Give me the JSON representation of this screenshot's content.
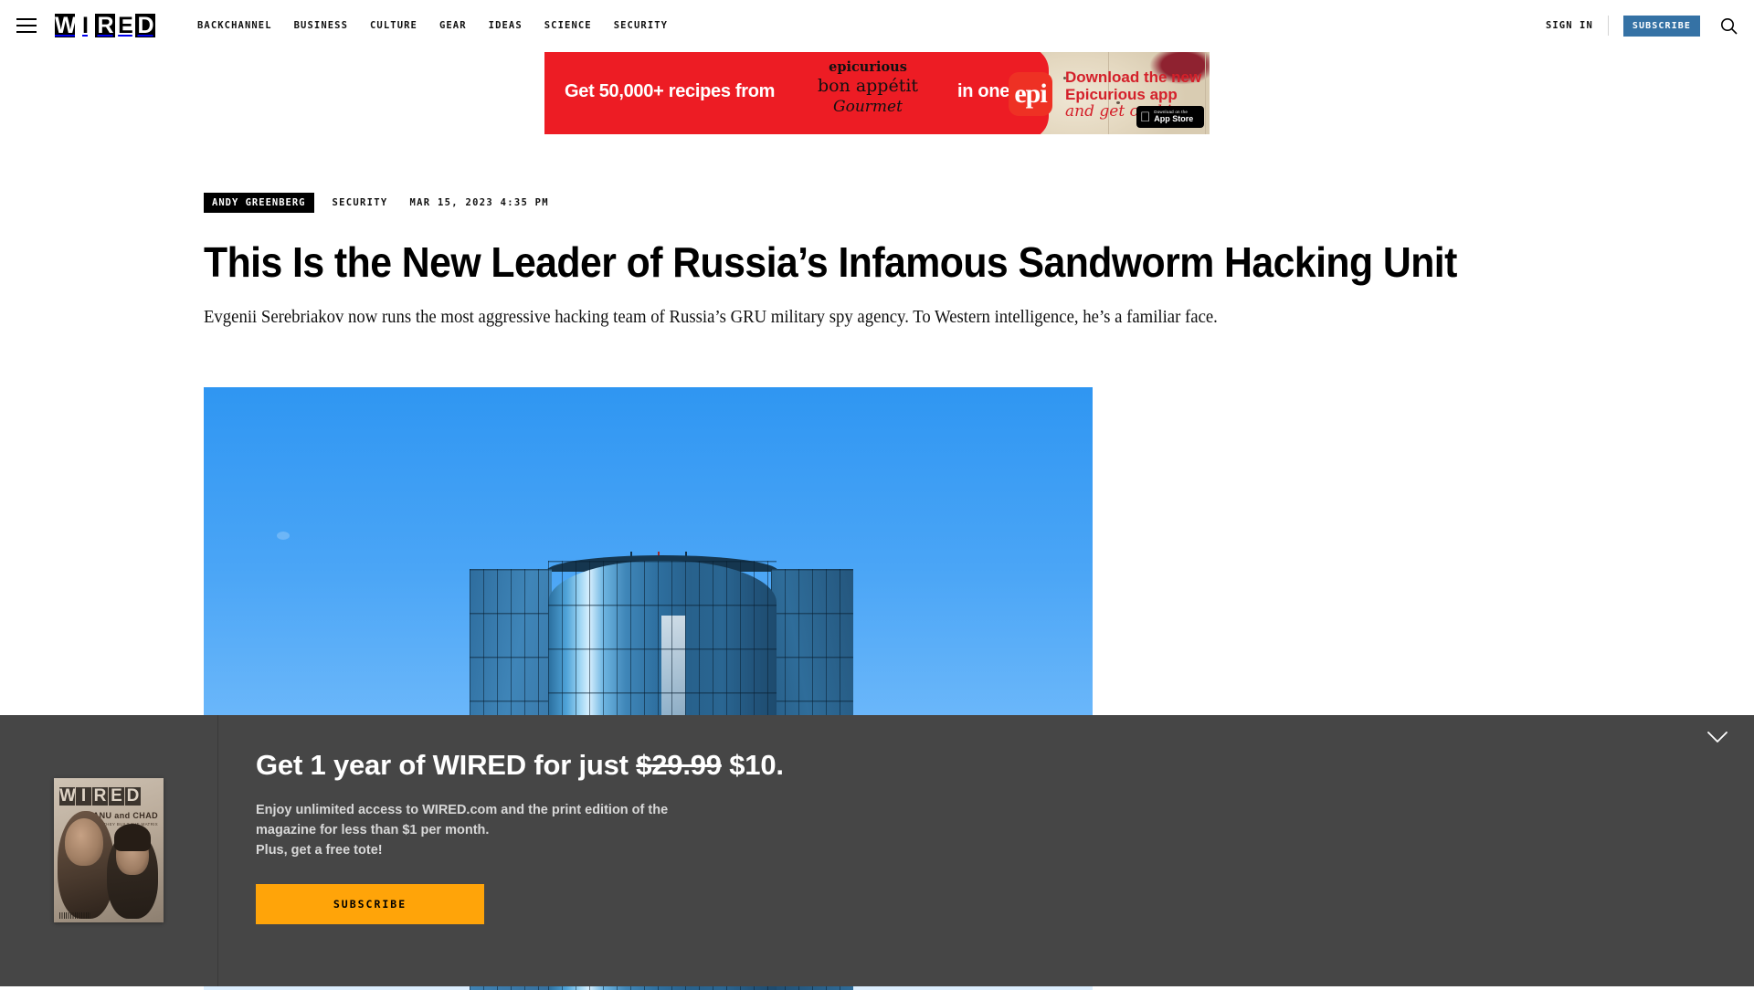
{
  "header": {
    "menu_icon": "hamburger-menu-icon",
    "logo_letters": [
      "W",
      "I",
      "R",
      "E",
      "D"
    ],
    "nav": [
      {
        "label": "BACKCHANNEL"
      },
      {
        "label": "BUSINESS"
      },
      {
        "label": "CULTURE"
      },
      {
        "label": "GEAR"
      },
      {
        "label": "IDEAS"
      },
      {
        "label": "SCIENCE"
      },
      {
        "label": "SECURITY"
      }
    ],
    "sign_in": "SIGN IN",
    "subscribe": "SUBSCRIBE",
    "search_icon": "search-icon",
    "subscribe_color": "#3572a5"
  },
  "ad": {
    "headline_left": "Get 50,000+ recipes from",
    "brand_epicurious": "epicurious",
    "brand_bonappetit": "bon appétit",
    "brand_gourmet": "Gourmet",
    "headline_right": "in one app.",
    "app_logo": "epi",
    "cta_line1": "Download the new",
    "cta_line2": "Epicurious app",
    "cta_line3": "and get cooking.",
    "appstore_small": "Download on the",
    "appstore_big": "App Store",
    "red": "#ed1c24"
  },
  "article": {
    "author": "ANDY GREENBERG",
    "category": "SECURITY",
    "date": "MAR 15, 2023 4:35 PM",
    "headline": "This Is the New Leader of Russia’s Infamous Sandworm Hacking Unit",
    "dek": "Evgenii Serebriakov now runs the most aggressive hacking team of Russia’s GRU military spy agency. To Western intelligence, he’s a familiar face.",
    "hero_image_alt": "blue glass office tower against clear blue sky"
  },
  "sub_banner": {
    "headline_prefix": "Get 1 year of WIRED for just ",
    "old_price": "$29.99",
    "new_price": " $10.",
    "body_line1": "Enjoy unlimited access to WIRED.com and the print edition of the",
    "body_line2": "magazine for less than $1 per month.",
    "body_line3": "Plus, get a free tote!",
    "cta": "SUBSCRIBE",
    "cta_color": "#ffa409",
    "background": "#464646",
    "close_icon": "chevron-down-icon",
    "magazine_cover": {
      "logo": [
        "W",
        "I",
        "R",
        "E",
        "D"
      ],
      "cover_title": "KEANU and CHAD",
      "cover_sub": "THEY BUILT THE MATRIX"
    }
  }
}
